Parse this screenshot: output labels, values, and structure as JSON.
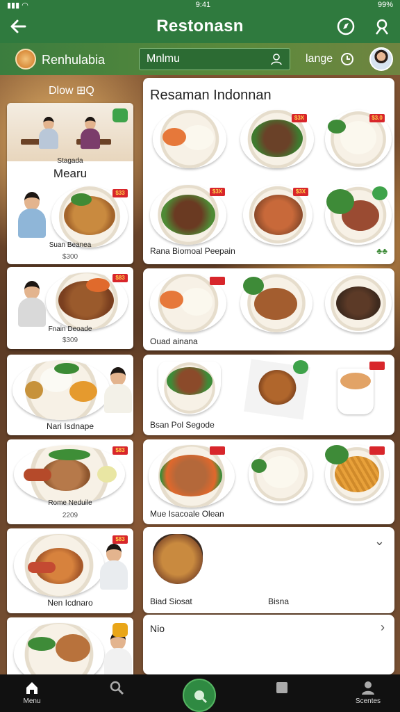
{
  "status_bar": {
    "time": "9:41",
    "battery": "99%"
  },
  "app_bar": {
    "title": "Restonasn"
  },
  "sub_bar": {
    "restaurant_name": "Renhulabia",
    "menu_field_value": "Mnlmu",
    "language_label": "lange"
  },
  "left_panel": {
    "filter_label": "Dlow  ⊞Q",
    "header_card": {
      "small_label": "Stagada",
      "title": "Mearu"
    },
    "cards": [
      {
        "label": "Suan Beanea",
        "price": "$300"
      },
      {
        "label": "Fnain Deoade",
        "price": "$309"
      },
      {
        "label": "Nari Isdnape",
        "price": ""
      },
      {
        "label": "Rome Neduile",
        "price": "2209"
      },
      {
        "label": "Nen Icdnaro",
        "price": ""
      },
      {
        "label": "",
        "price": ""
      }
    ],
    "badges": [
      "$33",
      "$83",
      "",
      "$83",
      "$83"
    ]
  },
  "right_panel": {
    "section_title": "Resaman Indonnan",
    "badges": [
      "$3X",
      "$3.0",
      "$3X",
      "$3X"
    ],
    "groups": [
      {
        "label": "Rana Biomoal Peepain"
      },
      {
        "label": "Ouad ainana"
      },
      {
        "label": "Bsan  Pol Segode"
      },
      {
        "label": "Mue Isacoale Olean"
      },
      {
        "label": "Biad Siosat",
        "label2": "Bisna"
      },
      {
        "label": "Nio"
      }
    ]
  },
  "bottom_nav": {
    "items": [
      {
        "label": "Menu",
        "icon": "home-icon"
      },
      {
        "label": "",
        "icon": "search-icon"
      },
      {
        "label": "",
        "icon": "scan-icon"
      },
      {
        "label": "",
        "icon": "square-icon"
      },
      {
        "label": "Scentes",
        "icon": "person-icon"
      }
    ]
  },
  "colors": {
    "brand_green": "#2f7a3e",
    "badge_red": "#d8262b",
    "nav_bg": "#111111"
  }
}
